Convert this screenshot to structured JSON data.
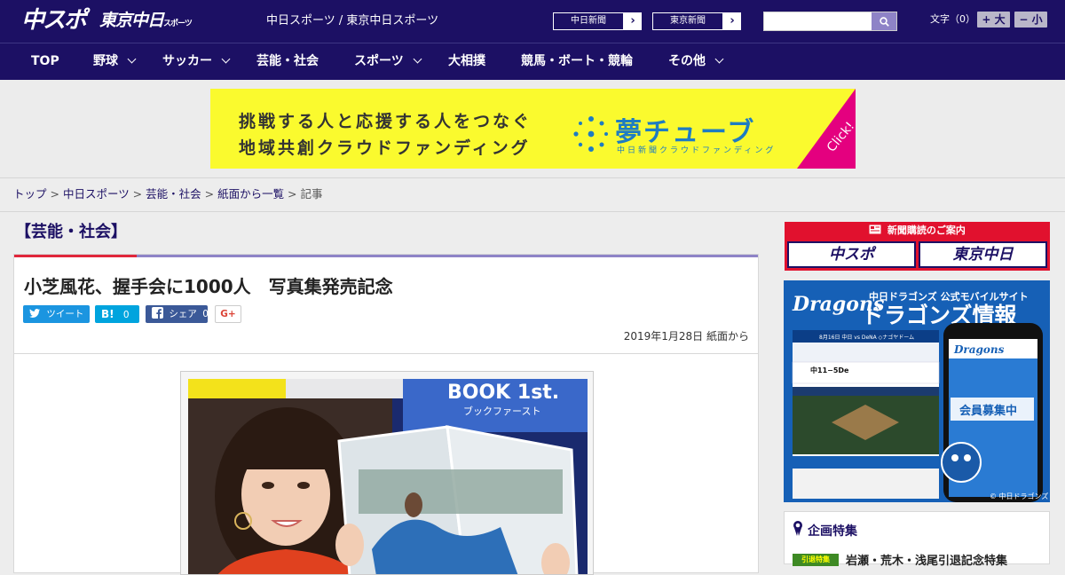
{
  "header": {
    "logo_chunichi": "中スポ",
    "logo_tokyo": "東京中日",
    "logo_tokyo_small": "スポーツ",
    "site_links": "中日スポーツ / 東京中日スポーツ",
    "paper_links": [
      "中日新聞",
      "東京新聞"
    ],
    "search_placeholder": "",
    "fontsize_label": "文字（0）",
    "fontsize_up": "+ 大",
    "fontsize_down": "− 小"
  },
  "nav": {
    "items": [
      {
        "label": "TOP",
        "has_menu": false
      },
      {
        "label": "野球",
        "has_menu": true
      },
      {
        "label": "サッカー",
        "has_menu": true
      },
      {
        "label": "芸能・社会",
        "has_menu": false
      },
      {
        "label": "スポーツ",
        "has_menu": true
      },
      {
        "label": "大相撲",
        "has_menu": false
      },
      {
        "label": "競馬・ボート・競輪",
        "has_menu": false
      },
      {
        "label": "その他",
        "has_menu": true
      }
    ]
  },
  "banner": {
    "line1": "挑戦する人と応援する人をつなぐ",
    "line2": "地域共創クラウドファンディング",
    "brand": "夢チューブ",
    "brand_sub": "中日新聞クラウドファンディング",
    "click": "Click!",
    "bg_color": "#fafa2e",
    "accent_color": "#e4007f"
  },
  "breadcrumb": {
    "items": [
      "トップ",
      "中日スポーツ",
      "芸能・社会",
      "紙面から一覧"
    ],
    "current": "記事"
  },
  "article": {
    "category": "【芸能・社会】",
    "headline": "小芝風花、握手会に1000人　写真集発売記念",
    "share": {
      "tweet": "ツイート",
      "hatena": "B!",
      "hatena_count": "0",
      "facebook": "シェア",
      "facebook_count": "0",
      "gplus": "G+"
    },
    "date": "2019年1月28日 紙面から",
    "photo_sign": "BOOK 1st.",
    "photo_sign_sub": "ブックファースト"
  },
  "sidebar": {
    "subscribe_header": "新聞購読のご案内",
    "subscribe_buttons": [
      "中スポ",
      "東京中日"
    ],
    "dragons_ad": {
      "logo": "Dragons",
      "title_small": "中日ドラゴンズ 公式モバイルサイト",
      "title_big": "ドラゴンズ情報",
      "game_line": "8月16日 中日 vs DeNA ◇ナゴヤドーム",
      "score": "中11−5De",
      "member": "会員募集中",
      "footer": "© 中日ドラゴンズ"
    },
    "special_title": "企画特集",
    "special_item": "岩瀬・荒木・浅尾引退記念特集",
    "special_thumb": "引退特集"
  },
  "colors": {
    "brand_navy": "#1c1064",
    "accent_purple": "#8e83c7",
    "accent_red": "#e0263b",
    "twitter": "#1b95e0",
    "hatena": "#00a4de",
    "facebook": "#3b5998",
    "gplus": "#db4437"
  }
}
